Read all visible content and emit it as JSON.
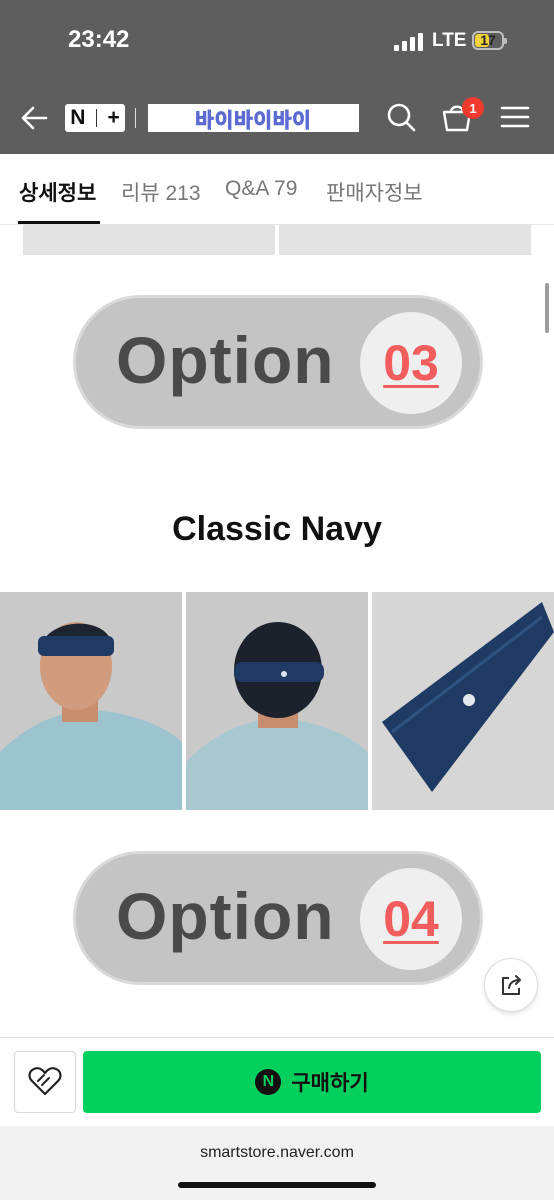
{
  "status_bar": {
    "time": "23:42",
    "network": "LTE",
    "battery": "17",
    "battery_color": "#f3d13a"
  },
  "header": {
    "nplus_logo": {
      "n": "N",
      "plus": "+"
    },
    "store_name": "바이바이바이",
    "cart_count": "1",
    "icons": [
      "back-arrow-icon",
      "search-icon",
      "cart-icon",
      "menu-icon"
    ]
  },
  "tabs": [
    {
      "label": "상세정보",
      "active": true
    },
    {
      "label": "리뷰 213",
      "active": false
    },
    {
      "label": "Q&A 79",
      "active": false
    },
    {
      "label": "판매자정보",
      "active": false
    }
  ],
  "content": {
    "option_word": "Option",
    "option_03_number": "03",
    "color_title": "Classic Navy",
    "option_04_number": "04"
  },
  "bottom_bar": {
    "buy_label": "구매하기",
    "buy_icon_letter": "N",
    "buy_color": "#03cf5d"
  },
  "browser": {
    "url": "smartstore.naver.com"
  }
}
